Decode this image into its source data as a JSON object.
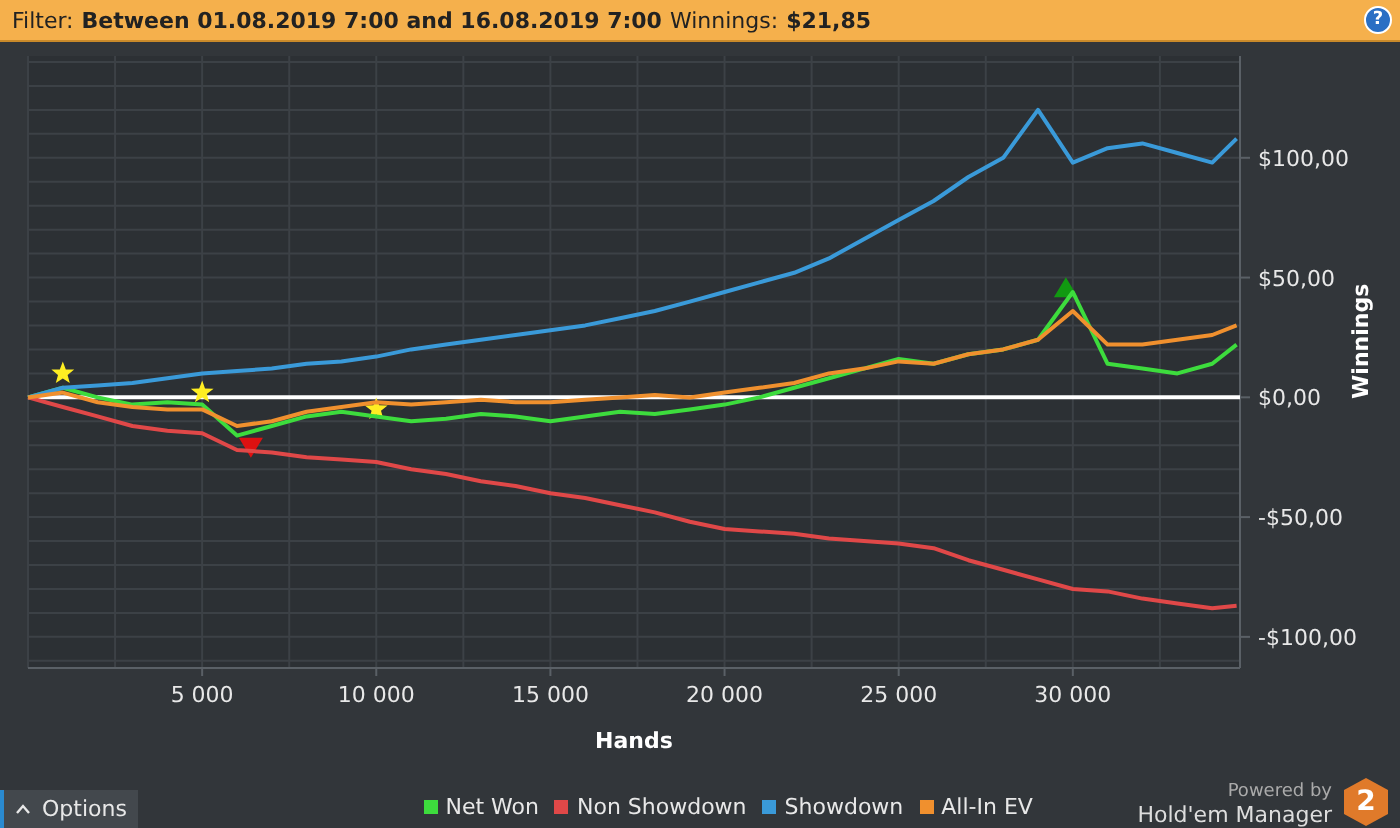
{
  "filter_bar": {
    "label": "Filter:",
    "value": "Between 01.08.2019 7:00 and 16.08.2019 7:00",
    "winnings_label": "Winnings:",
    "winnings_value": "$21,85",
    "help": "?"
  },
  "chart": {
    "chart_data": {
      "type": "line",
      "xlabel": "Hands",
      "ylabel": "Winnings",
      "xlim": [
        0,
        34800
      ],
      "ylim": [
        -113,
        142.5
      ],
      "xticks": [
        {
          "value": 5000,
          "label": "5 000"
        },
        {
          "value": 10000,
          "label": "10 000"
        },
        {
          "value": 15000,
          "label": "15 000"
        },
        {
          "value": 20000,
          "label": "20 000"
        },
        {
          "value": 25000,
          "label": "25 000"
        },
        {
          "value": 30000,
          "label": "30 000"
        }
      ],
      "yticks": [
        {
          "value": 100,
          "label": "$100,00"
        },
        {
          "value": 50,
          "label": "$50,00"
        },
        {
          "value": 0,
          "label": "$0,00"
        },
        {
          "value": -50,
          "label": "-$50,00"
        },
        {
          "value": -100,
          "label": "-$100,00"
        }
      ],
      "x": [
        0,
        1000,
        2000,
        3000,
        4000,
        5000,
        6000,
        7000,
        8000,
        9000,
        10000,
        11000,
        12000,
        13000,
        14000,
        15000,
        16000,
        17000,
        18000,
        19000,
        20000,
        21000,
        22000,
        23000,
        24000,
        25000,
        26000,
        27000,
        28000,
        29000,
        30000,
        31000,
        32000,
        33000,
        34000,
        34700
      ],
      "series": [
        {
          "name": "Net Won",
          "color": "#3ddc3d",
          "values": [
            0,
            4,
            0,
            -3,
            -2,
            -3,
            -16,
            -12,
            -8,
            -6,
            -8,
            -10,
            -9,
            -7,
            -8,
            -10,
            -8,
            -6,
            -7,
            -5,
            -3,
            0,
            4,
            8,
            12,
            16,
            14,
            18,
            20,
            24,
            44,
            14,
            12,
            10,
            14,
            22
          ]
        },
        {
          "name": "Non Showdown",
          "color": "#e04848",
          "values": [
            0,
            -4,
            -8,
            -12,
            -14,
            -15,
            -22,
            -23,
            -25,
            -26,
            -27,
            -30,
            -32,
            -35,
            -37,
            -40,
            -42,
            -45,
            -48,
            -52,
            -55,
            -56,
            -57,
            -59,
            -60,
            -61,
            -63,
            -68,
            -72,
            -76,
            -80,
            -81,
            -84,
            -86,
            -88,
            -87
          ]
        },
        {
          "name": "Showdown",
          "color": "#3a9ad9",
          "values": [
            0,
            4,
            5,
            6,
            8,
            10,
            11,
            12,
            14,
            15,
            17,
            20,
            22,
            24,
            26,
            28,
            30,
            33,
            36,
            40,
            44,
            48,
            52,
            58,
            66,
            74,
            82,
            92,
            100,
            120,
            98,
            104,
            106,
            102,
            98,
            108
          ]
        },
        {
          "name": "All-In EV",
          "color": "#f0902e",
          "values": [
            0,
            2,
            -2,
            -4,
            -5,
            -5,
            -12,
            -10,
            -6,
            -4,
            -2,
            -3,
            -2,
            -1,
            -2,
            -2,
            -1,
            0,
            1,
            0,
            2,
            4,
            6,
            10,
            12,
            15,
            14,
            18,
            20,
            24,
            36,
            22,
            22,
            24,
            26,
            30
          ]
        }
      ],
      "grid": true
    }
  },
  "footer": {
    "options": "Options",
    "powered_by": "Powered by",
    "product": "Hold'em Manager",
    "logo": "2"
  }
}
